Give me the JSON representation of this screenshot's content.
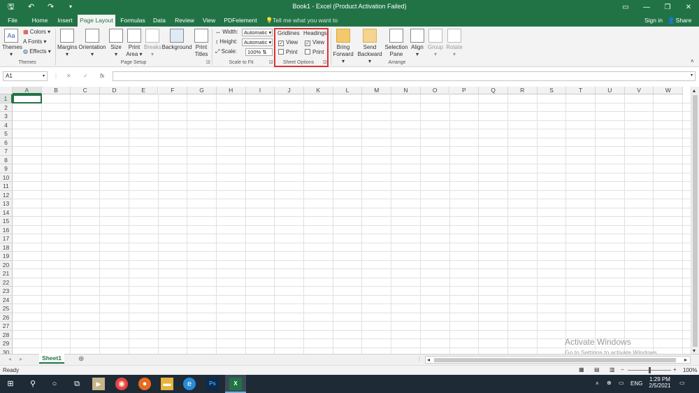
{
  "window": {
    "title": "Book1 - Excel (Product Activation Failed)",
    "quick_access": {
      "save_icon": "save-icon",
      "undo_icon": "undo-icon",
      "redo_icon": "redo-icon",
      "customize": "▾"
    },
    "controls": {
      "ribbon_display": "▭",
      "minimize": "—",
      "restore": "❐",
      "close": "✕"
    }
  },
  "tabs": [
    "File",
    "Home",
    "Insert",
    "Page Layout",
    "Formulas",
    "Data",
    "Review",
    "View",
    "PDFelement"
  ],
  "active_tab": "Page Layout",
  "tell_me": "Tell me what you want to do...",
  "signin": "Sign in",
  "share": "Share",
  "ribbon": {
    "themes": {
      "button": "Themes",
      "colors": "Colors",
      "fonts": "Fonts",
      "effects": "Effects",
      "group": "Themes"
    },
    "page_setup": {
      "margins": "Margins",
      "orientation": "Orientation",
      "size": "Size",
      "print_area_1": "Print",
      "print_area_2": "Area",
      "breaks": "Breaks",
      "background": "Background",
      "print_titles_1": "Print",
      "print_titles_2": "Titles",
      "group": "Page Setup"
    },
    "scale_to_fit": {
      "width_label": "Width:",
      "width_value": "Automatic",
      "height_label": "Height:",
      "height_value": "Automatic",
      "scale_label": "Scale:",
      "scale_value": "100%",
      "group": "Scale to Fit"
    },
    "sheet_options": {
      "gridlines": "Gridlines",
      "headings": "Headings",
      "view": "View",
      "print": "Print",
      "group": "Sheet Options",
      "gridlines_view_checked": true,
      "gridlines_print_checked": false,
      "headings_view_checked": true,
      "headings_print_checked": false
    },
    "arrange": {
      "bring_1": "Bring",
      "bring_2": "Forward",
      "send_1": "Send",
      "send_2": "Backward",
      "selection_1": "Selection",
      "selection_2": "Pane",
      "align": "Align",
      "group_btn": "Group",
      "rotate": "Rotate",
      "group": "Arrange"
    }
  },
  "formula_bar": {
    "name_box": "A1",
    "cancel": "✕",
    "enter": "✓",
    "fx": "fx",
    "value": ""
  },
  "columns": [
    "A",
    "B",
    "C",
    "D",
    "E",
    "F",
    "G",
    "H",
    "I",
    "J",
    "K",
    "L",
    "M",
    "N",
    "O",
    "P",
    "Q",
    "R",
    "S",
    "T",
    "U",
    "V",
    "W"
  ],
  "rows": [
    "1",
    "2",
    "3",
    "4",
    "5",
    "6",
    "7",
    "8",
    "9",
    "10",
    "11",
    "12",
    "13",
    "14",
    "15",
    "16",
    "17",
    "18",
    "19",
    "20",
    "21",
    "22",
    "23",
    "24",
    "25",
    "26",
    "27",
    "28",
    "29",
    "30"
  ],
  "sheet_tabs": [
    "Sheet1"
  ],
  "status": {
    "ready": "Ready",
    "zoom": "100%"
  },
  "watermark": {
    "line1": "Activate Windows",
    "line2": "Go to Settings to activate Windows."
  },
  "taskbar": {
    "lang": "ENG",
    "time": "1:29 PM",
    "date": "2/5/2021"
  },
  "colors": {
    "excel_green": "#217346",
    "highlight": "#e03030"
  }
}
